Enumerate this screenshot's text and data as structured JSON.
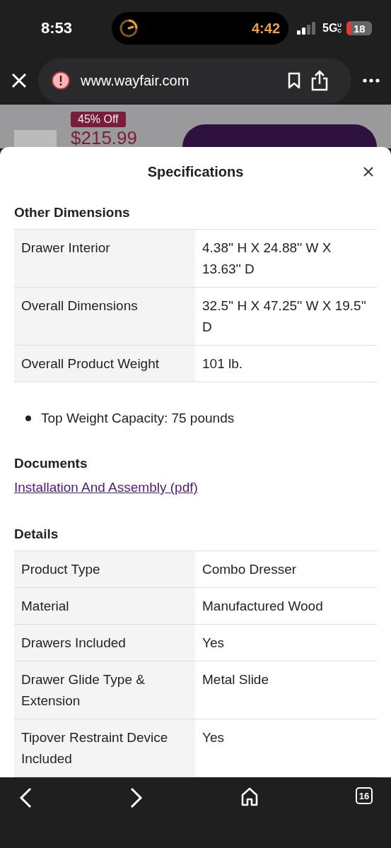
{
  "status_bar": {
    "time": "8:53",
    "timer": "4:42",
    "network": "5G",
    "network_sub": "UC",
    "battery": "18"
  },
  "browser": {
    "url": "www.wayfair.com"
  },
  "product": {
    "badge": "45% Off",
    "price": "$215.99"
  },
  "sheet": {
    "title": "Specifications",
    "sections": [
      {
        "kind": "table",
        "heading": "Other Dimensions",
        "rows": [
          {
            "label": "Drawer Interior",
            "value": "4.38'' H X 24.88'' W X 13.63'' D"
          },
          {
            "label": "Overall Dimensions",
            "value": "32.5'' H X 47.25'' W X 19.5'' D"
          },
          {
            "label": "Overall Product Weight",
            "value": "101 lb."
          }
        ]
      },
      {
        "kind": "bullets",
        "items": [
          "Top Weight Capacity: 75 pounds"
        ]
      },
      {
        "kind": "links",
        "heading": "Documents",
        "links": [
          "Installation And Assembly (pdf)"
        ]
      },
      {
        "kind": "table",
        "heading": "Details",
        "rows": [
          {
            "label": "Product Type",
            "value": "Combo Dresser"
          },
          {
            "label": "Material",
            "value": "Manufactured Wood"
          },
          {
            "label": "Drawers Included",
            "value": "Yes"
          },
          {
            "label": "Drawer Glide Type & Extension",
            "value": "Metal Slide"
          },
          {
            "label": "Tipover Restraint Device Included",
            "value": "Yes"
          }
        ]
      }
    ]
  },
  "toolbar": {
    "tabs": "16"
  }
}
